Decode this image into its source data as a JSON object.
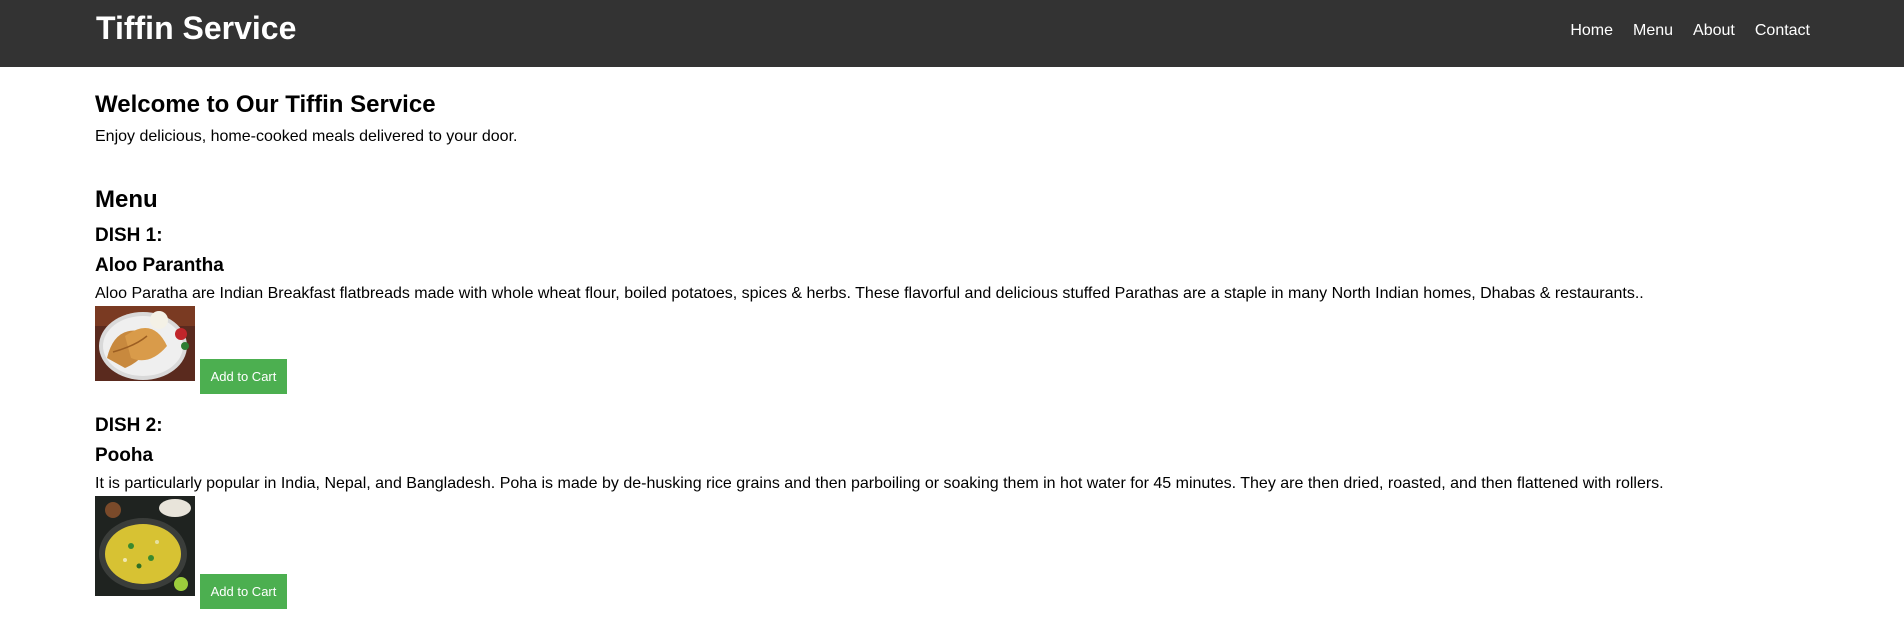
{
  "header": {
    "brand": "Tiffin Service",
    "nav": [
      "Home",
      "Menu",
      "About",
      "Contact"
    ]
  },
  "welcome": {
    "title": "Welcome to Our Tiffin Service",
    "text": "Enjoy delicious, home-cooked meals delivered to your door."
  },
  "menu": {
    "title": "Menu",
    "dishes": [
      {
        "number": "DISH 1:",
        "name": "Aloo Parantha",
        "description": "Aloo Paratha are Indian Breakfast flatbreads made with whole wheat flour, boiled potatoes, spices & herbs. These flavorful and delicious stuffed Parathas are a staple in many North Indian homes, Dhabas & restaurants..",
        "button": "Add to Cart"
      },
      {
        "number": "DISH 2:",
        "name": "Pooha",
        "description": "It is particularly popular in India, Nepal, and Bangladesh. Poha is made by de-husking rice grains and then parboiling or soaking them in hot water for 45 minutes. They are then dried, roasted, and then flattened with rollers.",
        "button": "Add to Cart"
      }
    ]
  },
  "colors": {
    "header_bg": "#333333",
    "button_bg": "#4CAF50"
  }
}
